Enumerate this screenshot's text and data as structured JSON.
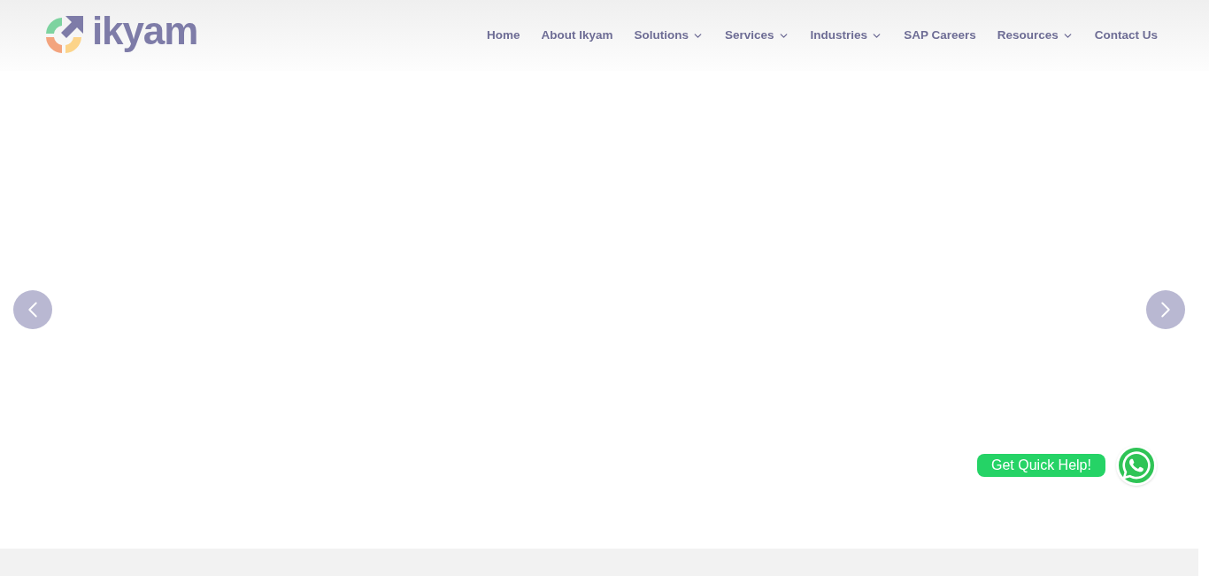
{
  "logo": {
    "text": "ikyam"
  },
  "nav": [
    {
      "label": "Home",
      "dropdown": false
    },
    {
      "label": "About Ikyam",
      "dropdown": false
    },
    {
      "label": "Solutions",
      "dropdown": true
    },
    {
      "label": "Services",
      "dropdown": true
    },
    {
      "label": "Industries",
      "dropdown": true
    },
    {
      "label": "SAP Careers",
      "dropdown": false
    },
    {
      "label": "Resources",
      "dropdown": true
    },
    {
      "label": "Contact Us",
      "dropdown": false
    }
  ],
  "help": {
    "label": "Get Quick Help!"
  }
}
